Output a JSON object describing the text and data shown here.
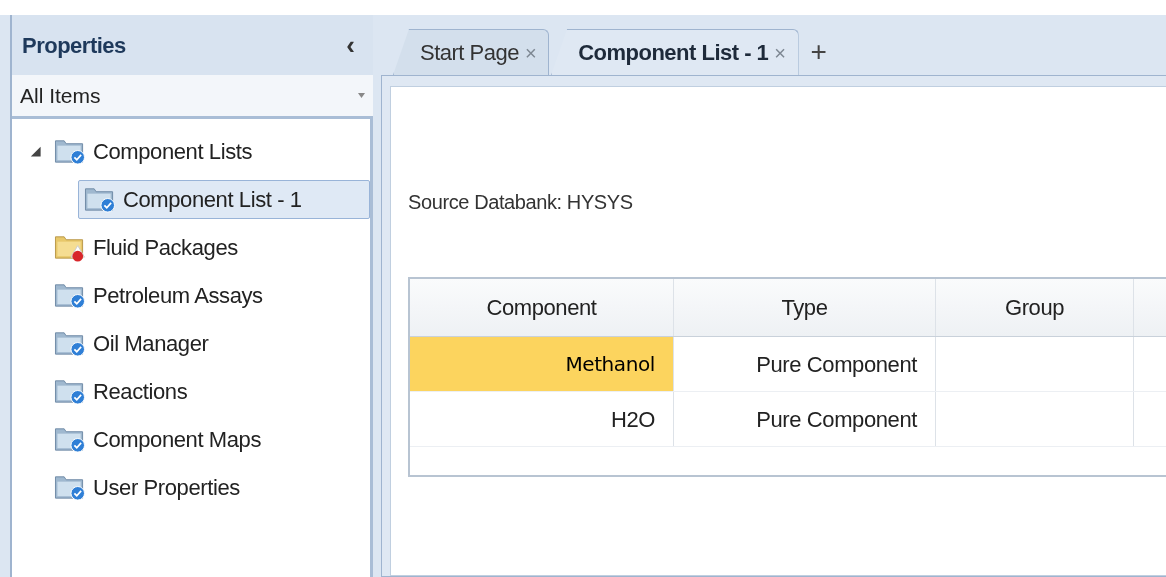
{
  "sidebar": {
    "title": "Properties",
    "collapse_glyph": "‹",
    "filter": {
      "value": "All Items"
    },
    "items": [
      {
        "label": "Component Lists",
        "kind": "check",
        "selected": false,
        "expanded": true,
        "children": [
          {
            "label": "Component List - 1",
            "kind": "check",
            "selected": true
          }
        ]
      },
      {
        "label": "Fluid Packages",
        "kind": "alert",
        "selected": false
      },
      {
        "label": "Petroleum Assays",
        "kind": "check",
        "selected": false
      },
      {
        "label": "Oil Manager",
        "kind": "check",
        "selected": false
      },
      {
        "label": "Reactions",
        "kind": "check",
        "selected": false
      },
      {
        "label": "Component Maps",
        "kind": "check",
        "selected": false
      },
      {
        "label": "User Properties",
        "kind": "check",
        "selected": false
      }
    ]
  },
  "tabs": [
    {
      "label": "Start Page",
      "close_glyph": "×",
      "selected": false
    },
    {
      "label": "Component List - 1",
      "close_glyph": "×",
      "selected": true
    }
  ],
  "new_tab_glyph": "+",
  "source_databank": "Source Databank: HYSYS",
  "table": {
    "columns": [
      "Component",
      "Type",
      "Group"
    ],
    "rows": [
      {
        "component": "Methanol",
        "type": "Pure Component",
        "highlighted": true
      },
      {
        "component": "H2O",
        "type": "Pure Component",
        "highlighted": false
      }
    ]
  }
}
